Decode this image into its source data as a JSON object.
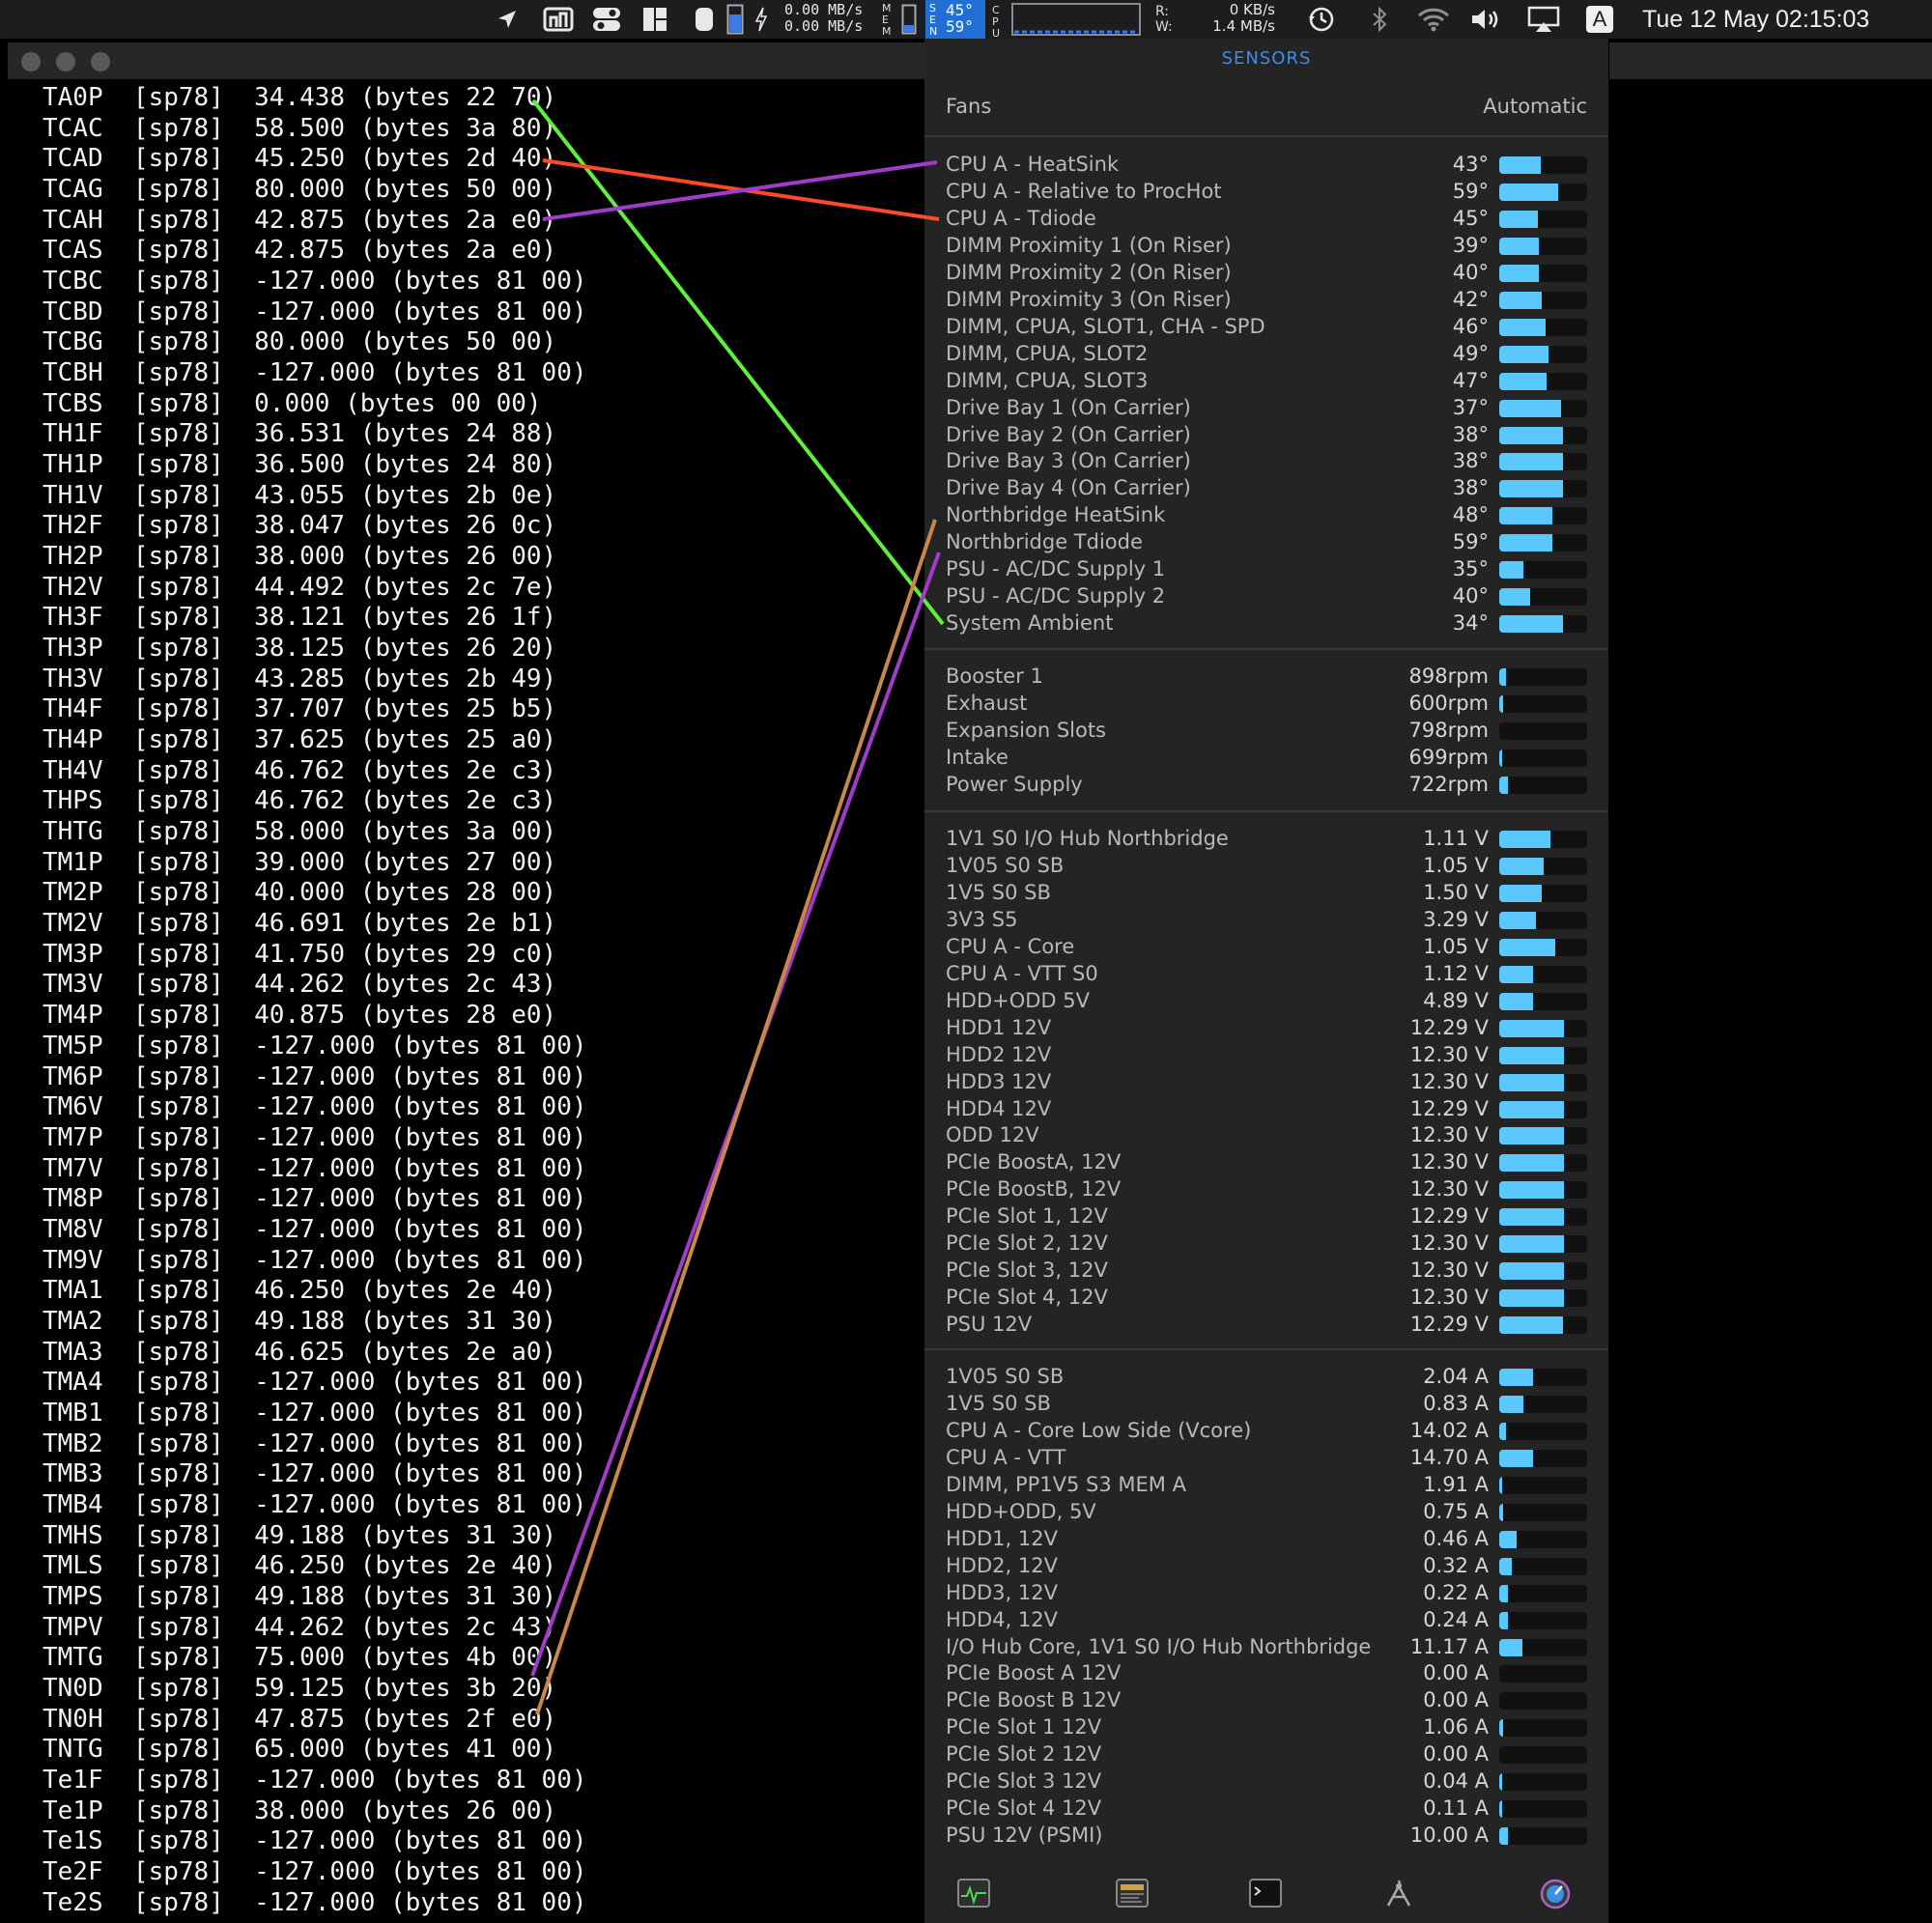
{
  "menubar": {
    "net_up": "0.00 MB/s",
    "net_down": "0.00 MB/s",
    "mem_letters": [
      "M",
      "E",
      "M"
    ],
    "sensor_letters": [
      "S",
      "E",
      "N"
    ],
    "sensor_top": "45°",
    "sensor_bottom": "59°",
    "cpu_letters": [
      "C",
      "P",
      "U"
    ],
    "disk_r_label": "R:",
    "disk_w_label": "W:",
    "disk_read": "0 KB/s",
    "disk_write": "1.4 MB/s",
    "keyboard_letter": "A",
    "clock": "Tue 12 May  02:15:03"
  },
  "terminal": {
    "lines": [
      "TA0P  [sp78]  34.438 (bytes 22 70)",
      "TCAC  [sp78]  58.500 (bytes 3a 80)",
      "TCAD  [sp78]  45.250 (bytes 2d 40)",
      "TCAG  [sp78]  80.000 (bytes 50 00)",
      "TCAH  [sp78]  42.875 (bytes 2a e0)",
      "TCAS  [sp78]  42.875 (bytes 2a e0)",
      "TCBC  [sp78]  -127.000 (bytes 81 00)",
      "TCBD  [sp78]  -127.000 (bytes 81 00)",
      "TCBG  [sp78]  80.000 (bytes 50 00)",
      "TCBH  [sp78]  -127.000 (bytes 81 00)",
      "TCBS  [sp78]  0.000 (bytes 00 00)",
      "TH1F  [sp78]  36.531 (bytes 24 88)",
      "TH1P  [sp78]  36.500 (bytes 24 80)",
      "TH1V  [sp78]  43.055 (bytes 2b 0e)",
      "TH2F  [sp78]  38.047 (bytes 26 0c)",
      "TH2P  [sp78]  38.000 (bytes 26 00)",
      "TH2V  [sp78]  44.492 (bytes 2c 7e)",
      "TH3F  [sp78]  38.121 (bytes 26 1f)",
      "TH3P  [sp78]  38.125 (bytes 26 20)",
      "TH3V  [sp78]  43.285 (bytes 2b 49)",
      "TH4F  [sp78]  37.707 (bytes 25 b5)",
      "TH4P  [sp78]  37.625 (bytes 25 a0)",
      "TH4V  [sp78]  46.762 (bytes 2e c3)",
      "THPS  [sp78]  46.762 (bytes 2e c3)",
      "THTG  [sp78]  58.000 (bytes 3a 00)",
      "TM1P  [sp78]  39.000 (bytes 27 00)",
      "TM2P  [sp78]  40.000 (bytes 28 00)",
      "TM2V  [sp78]  46.691 (bytes 2e b1)",
      "TM3P  [sp78]  41.750 (bytes 29 c0)",
      "TM3V  [sp78]  44.262 (bytes 2c 43)",
      "TM4P  [sp78]  40.875 (bytes 28 e0)",
      "TM5P  [sp78]  -127.000 (bytes 81 00)",
      "TM6P  [sp78]  -127.000 (bytes 81 00)",
      "TM6V  [sp78]  -127.000 (bytes 81 00)",
      "TM7P  [sp78]  -127.000 (bytes 81 00)",
      "TM7V  [sp78]  -127.000 (bytes 81 00)",
      "TM8P  [sp78]  -127.000 (bytes 81 00)",
      "TM8V  [sp78]  -127.000 (bytes 81 00)",
      "TM9V  [sp78]  -127.000 (bytes 81 00)",
      "TMA1  [sp78]  46.250 (bytes 2e 40)",
      "TMA2  [sp78]  49.188 (bytes 31 30)",
      "TMA3  [sp78]  46.625 (bytes 2e a0)",
      "TMA4  [sp78]  -127.000 (bytes 81 00)",
      "TMB1  [sp78]  -127.000 (bytes 81 00)",
      "TMB2  [sp78]  -127.000 (bytes 81 00)",
      "TMB3  [sp78]  -127.000 (bytes 81 00)",
      "TMB4  [sp78]  -127.000 (bytes 81 00)",
      "TMHS  [sp78]  49.188 (bytes 31 30)",
      "TMLS  [sp78]  46.250 (bytes 2e 40)",
      "TMPS  [sp78]  49.188 (bytes 31 30)",
      "TMPV  [sp78]  44.262 (bytes 2c 43)",
      "TMTG  [sp78]  75.000 (bytes 4b 00)",
      "TN0D  [sp78]  59.125 (bytes 3b 20)",
      "TN0H  [sp78]  47.875 (bytes 2f e0)",
      "TNTG  [sp78]  65.000 (bytes 41 00)",
      "Te1F  [sp78]  -127.000 (bytes 81 00)",
      "Te1P  [sp78]  38.000 (bytes 26 00)",
      "Te1S  [sp78]  -127.000 (bytes 81 00)",
      "Te2F  [sp78]  -127.000 (bytes 81 00)",
      "Te2S  [sp78]  -127.000 (bytes 81 00)"
    ]
  },
  "panel": {
    "title": "SENSORS",
    "fans_header": "Fans",
    "fans_mode": "Automatic",
    "temperatures": [
      {
        "name": "CPU A - HeatSink",
        "value": "43°",
        "level": 0.47
      },
      {
        "name": "CPU A - Relative to ProcHot",
        "value": "59°",
        "level": 0.67
      },
      {
        "name": "CPU A - Tdiode",
        "value": "45°",
        "level": 0.44
      },
      {
        "name": "DIMM Proximity 1 (On Riser)",
        "value": "39°",
        "level": 0.45
      },
      {
        "name": "DIMM Proximity 2 (On Riser)",
        "value": "40°",
        "level": 0.45
      },
      {
        "name": "DIMM Proximity 3 (On Riser)",
        "value": "42°",
        "level": 0.48
      },
      {
        "name": "DIMM, CPUA, SLOT1, CHA - SPD",
        "value": "46°",
        "level": 0.53
      },
      {
        "name": "DIMM, CPUA, SLOT2",
        "value": "49°",
        "level": 0.56
      },
      {
        "name": "DIMM, CPUA, SLOT3",
        "value": "47°",
        "level": 0.54
      },
      {
        "name": "Drive Bay 1 (On Carrier)",
        "value": "37°",
        "level": 0.7
      },
      {
        "name": "Drive Bay 2 (On Carrier)",
        "value": "38°",
        "level": 0.72
      },
      {
        "name": "Drive Bay 3 (On Carrier)",
        "value": "38°",
        "level": 0.72
      },
      {
        "name": "Drive Bay 4 (On Carrier)",
        "value": "38°",
        "level": 0.72
      },
      {
        "name": "Northbridge HeatSink",
        "value": "48°",
        "level": 0.6
      },
      {
        "name": "Northbridge Tdiode",
        "value": "59°",
        "level": 0.6
      },
      {
        "name": "PSU - AC/DC Supply 1",
        "value": "35°",
        "level": 0.28
      },
      {
        "name": "PSU - AC/DC Supply 2",
        "value": "40°",
        "level": 0.35
      },
      {
        "name": "System Ambient",
        "value": "34°",
        "level": 0.72
      }
    ],
    "fans": [
      {
        "name": "Booster 1",
        "value": "898rpm",
        "level": 0.08
      },
      {
        "name": "Exhaust",
        "value": "600rpm",
        "level": 0.04
      },
      {
        "name": "Expansion Slots",
        "value": "798rpm",
        "level": 0.0
      },
      {
        "name": "Intake",
        "value": "699rpm",
        "level": 0.03
      },
      {
        "name": "Power Supply",
        "value": "722rpm",
        "level": 0.1
      }
    ],
    "voltages": [
      {
        "name": "1V1 S0 I/O Hub Northbridge",
        "value": "1.11 V",
        "level": 0.58
      },
      {
        "name": "1V05 S0 SB",
        "value": "1.05 V",
        "level": 0.5
      },
      {
        "name": "1V5 S0 SB",
        "value": "1.50 V",
        "level": 0.48
      },
      {
        "name": "3V3 S5",
        "value": "3.29 V",
        "level": 0.42
      },
      {
        "name": "CPU A - Core",
        "value": "1.05 V",
        "level": 0.64
      },
      {
        "name": "CPU A - VTT S0",
        "value": "1.12 V",
        "level": 0.38
      },
      {
        "name": "HDD+ODD 5V",
        "value": "4.89 V",
        "level": 0.38
      },
      {
        "name": "HDD1 12V",
        "value": "12.29 V",
        "level": 0.74
      },
      {
        "name": "HDD2 12V",
        "value": "12.30 V",
        "level": 0.74
      },
      {
        "name": "HDD3 12V",
        "value": "12.30 V",
        "level": 0.74
      },
      {
        "name": "HDD4 12V",
        "value": "12.29 V",
        "level": 0.74
      },
      {
        "name": "ODD 12V",
        "value": "12.30 V",
        "level": 0.74
      },
      {
        "name": "PCIe BoostA, 12V",
        "value": "12.30 V",
        "level": 0.74
      },
      {
        "name": "PCIe BoostB, 12V",
        "value": "12.30 V",
        "level": 0.74
      },
      {
        "name": "PCIe Slot 1, 12V",
        "value": "12.29 V",
        "level": 0.74
      },
      {
        "name": "PCIe Slot 2, 12V",
        "value": "12.30 V",
        "level": 0.74
      },
      {
        "name": "PCIe Slot 3, 12V",
        "value": "12.30 V",
        "level": 0.74
      },
      {
        "name": "PCIe Slot 4, 12V",
        "value": "12.30 V",
        "level": 0.74
      },
      {
        "name": "PSU 12V",
        "value": "12.29 V",
        "level": 0.72
      }
    ],
    "currents": [
      {
        "name": "1V05 S0 SB",
        "value": "2.04 A",
        "level": 0.38
      },
      {
        "name": "1V5 S0 SB",
        "value": "0.83 A",
        "level": 0.28
      },
      {
        "name": "CPU A - Core Low Side (Vcore)",
        "value": "14.02 A",
        "level": 0.08
      },
      {
        "name": "CPU A - VTT",
        "value": "14.70 A",
        "level": 0.38
      },
      {
        "name": "DIMM, PP1V5 S3 MEM A",
        "value": "1.91 A",
        "level": 0.02
      },
      {
        "name": "HDD+ODD, 5V",
        "value": "0.75 A",
        "level": 0.04
      },
      {
        "name": "HDD1, 12V",
        "value": "0.46 A",
        "level": 0.2
      },
      {
        "name": "HDD2, 12V",
        "value": "0.32 A",
        "level": 0.14
      },
      {
        "name": "HDD3, 12V",
        "value": "0.22 A",
        "level": 0.1
      },
      {
        "name": "HDD4, 12V",
        "value": "0.24 A",
        "level": 0.1
      },
      {
        "name": "I/O Hub Core, 1V1 S0 I/O Hub Northbridge",
        "value": "11.17 A",
        "level": 0.26
      },
      {
        "name": "PCIe Boost A 12V",
        "value": "0.00 A",
        "level": 0.0
      },
      {
        "name": "PCIe Boost B 12V",
        "value": "0.00 A",
        "level": 0.0
      },
      {
        "name": "PCIe Slot 1 12V",
        "value": "1.06 A",
        "level": 0.04
      },
      {
        "name": "PCIe Slot 2 12V",
        "value": "0.00 A",
        "level": 0.0
      },
      {
        "name": "PCIe Slot 3 12V",
        "value": "0.04 A",
        "level": 0.02
      },
      {
        "name": "PCIe Slot 4 12V",
        "value": "0.11 A",
        "level": 0.02
      },
      {
        "name": "PSU 12V (PSMI)",
        "value": "10.00 A",
        "level": 0.1
      }
    ],
    "footer_icons": [
      "activity-monitor-icon",
      "console-icon",
      "terminal-icon",
      "system-info-icon",
      "disk-utility-icon"
    ]
  },
  "colors": {
    "accent": "#3a8fe8",
    "bar_fill": "#5ac8fa",
    "panel_bg": "#242424",
    "line_green": "#5ef03a",
    "line_red": "#ff4a2a",
    "line_purple": "#a03cc8",
    "line_tan": "#c8884a"
  }
}
